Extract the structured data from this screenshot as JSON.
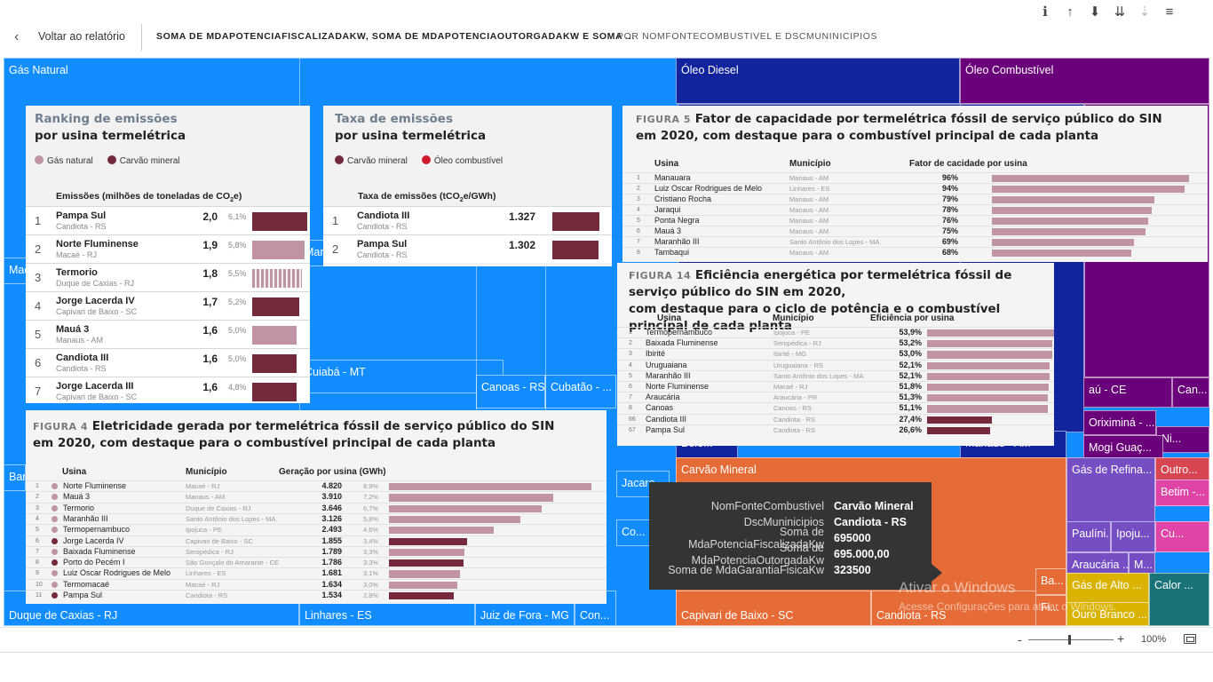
{
  "header": {
    "back_label": "Voltar ao relatório",
    "title": "SOMA DE MDAPOTENCIAFISCALIZADAKW, SOMA DE MDAPOTENCIAOUTORGADAKW E SOMA ...",
    "subtitle": "POR NOMFONTECOMBUSTIVEL E DSCMUNINICIPIOS"
  },
  "treemap": {
    "cells": [
      {
        "label": "Gás Natural",
        "color": "#118dff"
      },
      {
        "label": "Óleo Diesel",
        "color": "#12239e"
      },
      {
        "label": "Óleo Combustível",
        "color": "#6b007b"
      },
      {
        "label": "Mac",
        "color": "#118dff"
      },
      {
        "label": "Mar",
        "color": "#118dff"
      },
      {
        "label": "Cuiabá - MT",
        "color": "#118dff"
      },
      {
        "label": "Canoas - RS",
        "color": "#118dff"
      },
      {
        "label": "Cubatão - ...",
        "color": "#118dff"
      },
      {
        "label": "Bar",
        "color": "#118dff"
      },
      {
        "label": "Jacare",
        "color": "#118dff"
      },
      {
        "label": "Co...",
        "color": "#118dff"
      },
      {
        "label": "Duque de Caxias - RJ",
        "color": "#118dff"
      },
      {
        "label": "Linhares - ES",
        "color": "#118dff"
      },
      {
        "label": "Juiz de Fora - MG",
        "color": "#118dff"
      },
      {
        "label": "Con...",
        "color": "#118dff"
      },
      {
        "label": "Belé...",
        "color": "#12239e"
      },
      {
        "label": "Manaus - AM",
        "color": "#12239e"
      },
      {
        "label": "aú - CE",
        "color": "#6b007b"
      },
      {
        "label": "Can...",
        "color": "#6b007b"
      },
      {
        "label": "Oriximiná - ...",
        "color": "#6b007b"
      },
      {
        "label": "Ni...",
        "color": "#6b007b"
      },
      {
        "label": "Mogi Guaç...",
        "color": "#6b007b"
      },
      {
        "label": "Carvão Mineral",
        "color": "#e66c37"
      },
      {
        "label": "Capivari de Baixo - SC",
        "color": "#e66c37"
      },
      {
        "label": "Candiota - RS",
        "color": "#e66c37"
      },
      {
        "label": "Ba...",
        "color": "#e66c37"
      },
      {
        "label": "Fi...",
        "color": "#e66c37"
      },
      {
        "label": "Gás de Refina...",
        "color": "#744ec2"
      },
      {
        "label": "Paulíni...",
        "color": "#744ec2"
      },
      {
        "label": "Ipoju...",
        "color": "#744ec2"
      },
      {
        "label": "Araucária ...",
        "color": "#744ec2"
      },
      {
        "label": "M...",
        "color": "#744ec2"
      },
      {
        "label": "Outro...",
        "color": "#d64550"
      },
      {
        "label": "Betim -...",
        "color": "#e044a7"
      },
      {
        "label": "Cu...",
        "color": "#e044a7"
      },
      {
        "label": "Gás de Alto ...",
        "color": "#d9b300"
      },
      {
        "label": "Ouro Branco ...",
        "color": "#d9b300"
      },
      {
        "label": "Calor ...",
        "color": "#197278"
      }
    ]
  },
  "ranking_emissoes": {
    "title_line1": "Ranking de emissões",
    "title_line2": "por usina termelétrica",
    "legend": [
      {
        "label": "Gás natural",
        "color": "#c094a5"
      },
      {
        "label": "Carvão mineral",
        "color": "#742a3a"
      }
    ],
    "col_header_pre": "Emissões (milhões de toneladas de CO",
    "col_header_sub": "2",
    "col_header_mid": "e",
    "col_header_post": ")",
    "rows": [
      {
        "rank": "1",
        "name": "Pampa Sul",
        "loc": "Candiota - RS",
        "value": "2,0",
        "pct": "6,1%",
        "fuel": "carvao",
        "v": 2.0
      },
      {
        "rank": "2",
        "name": "Norte Fluminense",
        "loc": "Macaé - RJ",
        "value": "1,9",
        "pct": "5,8%",
        "fuel": "gas",
        "v": 1.9
      },
      {
        "rank": "3",
        "name": "Termorio",
        "loc": "Duque de Caxias - RJ",
        "value": "1,8",
        "pct": "5,5%",
        "fuel": "gas-striped",
        "v": 1.8
      },
      {
        "rank": "4",
        "name": "Jorge Lacerda IV",
        "loc": "Capivari de Baixo - SC",
        "value": "1,7",
        "pct": "5,2%",
        "fuel": "carvao",
        "v": 1.7
      },
      {
        "rank": "5",
        "name": "Mauá 3",
        "loc": "Manaus - AM",
        "value": "1,6",
        "pct": "5,0%",
        "fuel": "gas",
        "v": 1.6
      },
      {
        "rank": "6",
        "name": "Candiota III",
        "loc": "Candiota - RS",
        "value": "1,6",
        "pct": "5,0%",
        "fuel": "carvao",
        "v": 1.6
      },
      {
        "rank": "7",
        "name": "Jorge Lacerda III",
        "loc": "Capivari de Baixo - SC",
        "value": "1,6",
        "pct": "4,8%",
        "fuel": "carvao",
        "v": 1.6
      }
    ]
  },
  "taxa_emissoes": {
    "title_line1": "Taxa de emissões",
    "title_line2": "por usina termelétrica",
    "legend": [
      {
        "label": "Carvão mineral",
        "color": "#742a3a"
      },
      {
        "label": "Óleo combustível",
        "color": "#d1182b"
      }
    ],
    "col_header_pre": "Taxa de emissões (tCO",
    "col_header_sub": "2",
    "col_header_mid": "e",
    "col_header_post": "/GWh)",
    "rows": [
      {
        "rank": "1",
        "name": "Candiota III",
        "loc": "Candiota - RS",
        "value": "1.327",
        "v": 1327
      },
      {
        "rank": "2",
        "name": "Pampa Sul",
        "loc": "Candiota - RS",
        "value": "1.302",
        "v": 1302
      }
    ]
  },
  "figura5": {
    "fig_label": "FIGURA 5",
    "title_line1": "Fator de capacidade por termelétrica fóssil de serviço público do SIN",
    "title_line2": "em 2020, com destaque para o combustível principal de cada planta",
    "headers": {
      "usina": "Usina",
      "municipio": "Município",
      "metric": "Fator de cacidade por usina"
    },
    "rows": [
      {
        "idx": "1",
        "name": "Manauara",
        "city": "Manaus - AM",
        "value": "96%",
        "v": 96
      },
      {
        "idx": "2",
        "name": "Luiz Oscar Rodrigues de Melo",
        "city": "Linhares - ES",
        "value": "94%",
        "v": 94
      },
      {
        "idx": "3",
        "name": "Cristiano Rocha",
        "city": "Manaus - AM",
        "value": "79%",
        "v": 79
      },
      {
        "idx": "4",
        "name": "Jaraqui",
        "city": "Manaus - AM",
        "value": "78%",
        "v": 78
      },
      {
        "idx": "5",
        "name": "Ponta Negra",
        "city": "Manaus - AM",
        "value": "76%",
        "v": 76
      },
      {
        "idx": "6",
        "name": "Mauá 3",
        "city": "Manaus - AM",
        "value": "75%",
        "v": 75
      },
      {
        "idx": "7",
        "name": "Maranhão III",
        "city": "Santo Antônio dos Lopes - MA",
        "value": "69%",
        "v": 69
      },
      {
        "idx": "8",
        "name": "Tambaqui",
        "city": "Manaus - AM",
        "value": "68%",
        "v": 68
      }
    ]
  },
  "figura14": {
    "fig_label": "FIGURA 14",
    "title_line1": "Eficiência energética por termelétrica fóssil de serviço público do SIN em 2020,",
    "title_line2": "com destaque para o ciclo de potência e o combustível principal de cada planta",
    "headers": {
      "usina": "Usina",
      "municipio": "Município",
      "metric": "Eficiência por usina"
    },
    "rows": [
      {
        "idx": "1",
        "name": "Termopernambuco",
        "city": "Ipojuca - PE",
        "value": "53,9%",
        "v": 53.9,
        "fuel": "gas"
      },
      {
        "idx": "2",
        "name": "Baixada Fluminense",
        "city": "Seropédica - RJ",
        "value": "53,2%",
        "v": 53.2,
        "fuel": "gas"
      },
      {
        "idx": "3",
        "name": "Ibirité",
        "city": "Ibirité - MG",
        "value": "53,0%",
        "v": 53.0,
        "fuel": "gas"
      },
      {
        "idx": "4",
        "name": "Uruguaiana",
        "city": "Uruguaiana - RS",
        "value": "52,1%",
        "v": 52.1,
        "fuel": "gas"
      },
      {
        "idx": "5",
        "name": "Maranhão III",
        "city": "Santo Antônio dos Lopes - MA",
        "value": "52,1%",
        "v": 52.1,
        "fuel": "gas"
      },
      {
        "idx": "6",
        "name": "Norte Fluminense",
        "city": "Macaé - RJ",
        "value": "51,8%",
        "v": 51.8,
        "fuel": "gas"
      },
      {
        "idx": "7",
        "name": "Araucária",
        "city": "Araucária - PR",
        "value": "51,3%",
        "v": 51.3,
        "fuel": "gas"
      },
      {
        "idx": "8",
        "name": "Canoas",
        "city": "Canoas - RS",
        "value": "51,1%",
        "v": 51.1,
        "fuel": "gas"
      },
      {
        "idx": "66",
        "name": "Candiota III",
        "city": "Candiota - RS",
        "value": "27,4%",
        "v": 27.4,
        "fuel": "carvao"
      },
      {
        "idx": "67",
        "name": "Pampa Sul",
        "city": "Candiota - RS",
        "value": "26,6%",
        "v": 26.6,
        "fuel": "carvao"
      }
    ]
  },
  "figura4": {
    "fig_label": "FIGURA 4",
    "title_line1": "Eletricidade gerada por termelétrica fóssil de serviço público do SIN",
    "title_line2": "em 2020, com destaque para o combustível principal de cada planta",
    "headers": {
      "usina": "Usina",
      "municipio": "Município",
      "metric": "Geração por usina (GWh)"
    },
    "rows": [
      {
        "idx": "1",
        "name": "Norte Fluminense",
        "city": "Macaé - RJ",
        "value": "4.820",
        "pct": "8,9%",
        "v": 4820,
        "fuel": "gas"
      },
      {
        "idx": "2",
        "name": "Mauá 3",
        "city": "Manaus - AM",
        "value": "3.910",
        "pct": "7,2%",
        "v": 3910,
        "fuel": "gas"
      },
      {
        "idx": "3",
        "name": "Termorio",
        "city": "Duque de Caxias - RJ",
        "value": "3.646",
        "pct": "6,7%",
        "v": 3646,
        "fuel": "gas"
      },
      {
        "idx": "4",
        "name": "Maranhão III",
        "city": "Santo Antônio dos Lopes - MA",
        "value": "3.126",
        "pct": "5,8%",
        "v": 3126,
        "fuel": "gas"
      },
      {
        "idx": "5",
        "name": "Termopernambuco",
        "city": "Ipojuca - PE",
        "value": "2.493",
        "pct": "4,6%",
        "v": 2493,
        "fuel": "gas"
      },
      {
        "idx": "6",
        "name": "Jorge Lacerda IV",
        "city": "Capivari de Baixo - SC",
        "value": "1.855",
        "pct": "3,4%",
        "v": 1855,
        "fuel": "carvao"
      },
      {
        "idx": "7",
        "name": "Baixada Fluminense",
        "city": "Seropédica - RJ",
        "value": "1.789",
        "pct": "3,3%",
        "v": 1789,
        "fuel": "gas"
      },
      {
        "idx": "8",
        "name": "Porto do Pecém I",
        "city": "São Gonçalo do Amarante - CE",
        "value": "1.786",
        "pct": "3,3%",
        "v": 1786,
        "fuel": "carvao"
      },
      {
        "idx": "9",
        "name": "Luiz Oscar Rodrigues de Melo",
        "city": "Linhares - ES",
        "value": "1.681",
        "pct": "3,1%",
        "v": 1681,
        "fuel": "gas"
      },
      {
        "idx": "10",
        "name": "Termomacaé",
        "city": "Macaé - RJ",
        "value": "1.634",
        "pct": "3,0%",
        "v": 1634,
        "fuel": "gas"
      },
      {
        "idx": "11",
        "name": "Pampa Sul",
        "city": "Candiota - RS",
        "value": "1.534",
        "pct": "2,8%",
        "v": 1534,
        "fuel": "carvao"
      }
    ]
  },
  "tooltip": [
    {
      "key": "NomFonteCombustivel",
      "value": "Carvão Mineral"
    },
    {
      "key": "DscMuninicipios",
      "value": "Candiota - RS"
    },
    {
      "key": "Soma de MdaPotenciaFiscalizadaKw",
      "value": "695000"
    },
    {
      "key": "Soma de MdaPotenciaOutorgadaKw",
      "value": "695.000,00"
    },
    {
      "key": "Soma de MdaGarantiaFisicaKw",
      "value": "323500"
    }
  ],
  "watermark": {
    "line1": "Ativar o Windows",
    "line2": "Acesse Configurações para ativar o Windows."
  },
  "footer": {
    "zoom_minus": "-",
    "zoom_plus": "+",
    "zoom_level": "100%",
    "zoom_fraction": 0.48
  },
  "colors": {
    "gas": "#c094a5",
    "carvao": "#742a3a",
    "oleo": "#d1182b"
  }
}
